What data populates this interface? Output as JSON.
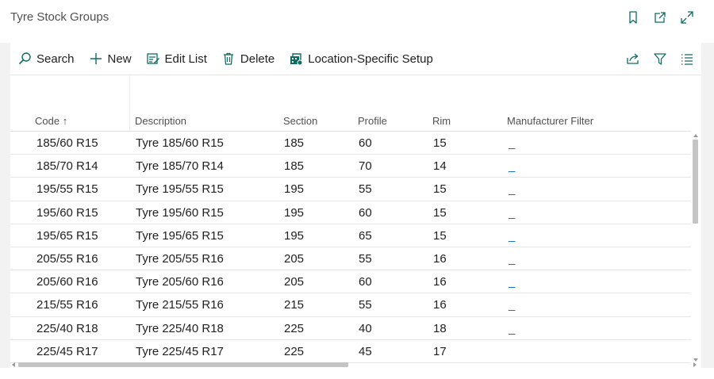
{
  "page": {
    "title": "Tyre Stock Groups"
  },
  "toolbar": {
    "search": "Search",
    "new": "New",
    "edit_list": "Edit List",
    "delete": "Delete",
    "location_setup": "Location-Specific Setup"
  },
  "columns": {
    "code": "Code",
    "code_sort": "↑",
    "description": "Description",
    "section": "Section",
    "profile": "Profile",
    "rim": "Rim",
    "manufacturer_filter": "Manufacturer Filter"
  },
  "rows": [
    {
      "code": "185/60 R15",
      "description": "Tyre 185/60 R15",
      "section": "185",
      "profile": "60",
      "rim": "15",
      "manufacturer_filter": "_"
    },
    {
      "code": "185/70 R14",
      "description": "Tyre 185/70 R14",
      "section": "185",
      "profile": "70",
      "rim": "14",
      "manufacturer_filter": "_"
    },
    {
      "code": "195/55 R15",
      "description": "Tyre 195/55 R15",
      "section": "195",
      "profile": "55",
      "rim": "15",
      "manufacturer_filter": "_"
    },
    {
      "code": "195/60 R15",
      "description": "Tyre 195/60 R15",
      "section": "195",
      "profile": "60",
      "rim": "15",
      "manufacturer_filter": "_"
    },
    {
      "code": "195/65 R15",
      "description": "Tyre 195/65 R15",
      "section": "195",
      "profile": "65",
      "rim": "15",
      "manufacturer_filter": "_"
    },
    {
      "code": "205/55 R16",
      "description": "Tyre 205/55 R16",
      "section": "205",
      "profile": "55",
      "rim": "16",
      "manufacturer_filter": "_"
    },
    {
      "code": "205/60 R16",
      "description": "Tyre 205/60 R16",
      "section": "205",
      "profile": "60",
      "rim": "16",
      "manufacturer_filter": "_"
    },
    {
      "code": "215/55 R16",
      "description": "Tyre 215/55 R16",
      "section": "215",
      "profile": "55",
      "rim": "16",
      "manufacturer_filter": "_"
    },
    {
      "code": "225/40 R18",
      "description": "Tyre 225/40 R18",
      "section": "225",
      "profile": "40",
      "rim": "18",
      "manufacturer_filter": "_"
    },
    {
      "code": "225/45 R17",
      "description": "Tyre 225/45 R17",
      "section": "225",
      "profile": "45",
      "rim": "17",
      "manufacturer_filter": ""
    }
  ],
  "icons": {
    "bookmark": "bookmark-icon",
    "open_new_window": "open-new-window-icon",
    "expand": "expand-icon",
    "search": "search-icon",
    "new": "plus-icon",
    "edit_list": "edit-list-icon",
    "delete": "trash-icon",
    "location_setup": "location-setup-icon",
    "share": "share-icon",
    "filter": "filter-icon",
    "list": "list-view-icon"
  },
  "colors": {
    "accent": "#0f6cbd",
    "icon": "#0f6c63"
  }
}
